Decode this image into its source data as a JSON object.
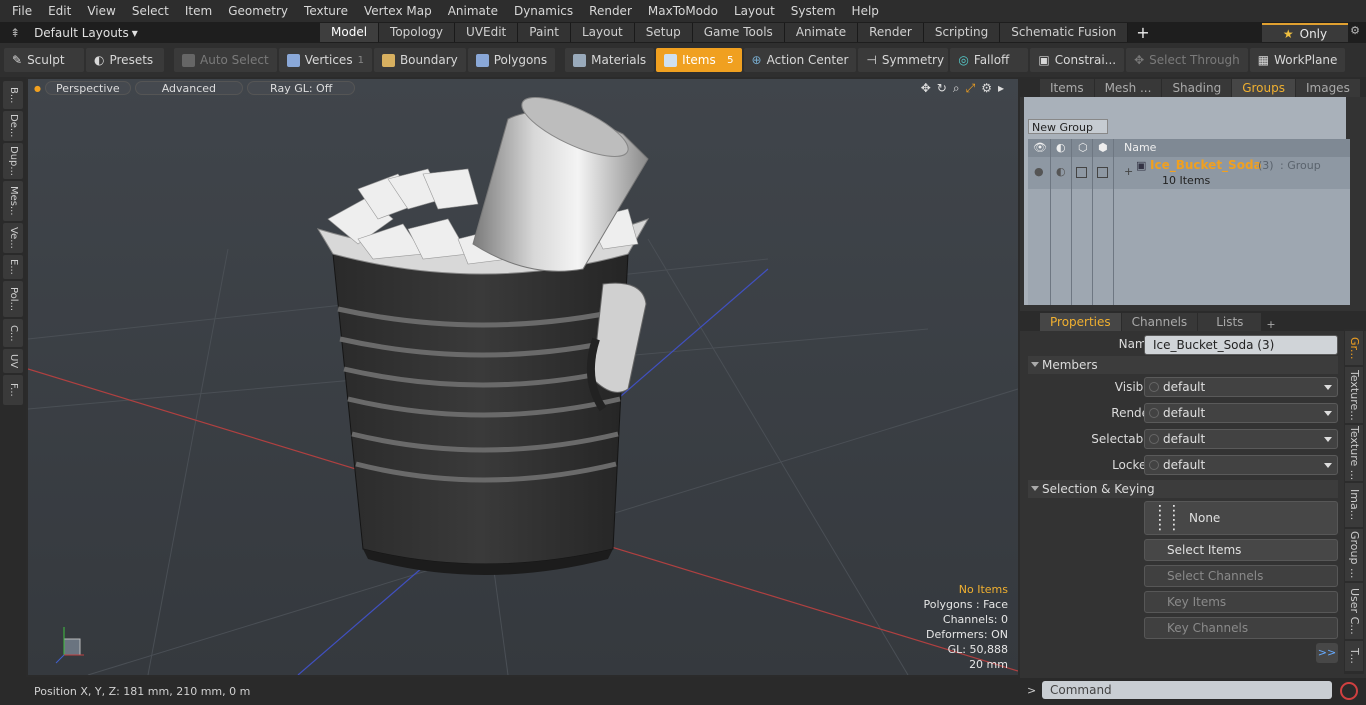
{
  "menu": [
    "File",
    "Edit",
    "View",
    "Select",
    "Item",
    "Geometry",
    "Texture",
    "Vertex Map",
    "Animate",
    "Dynamics",
    "Render",
    "MaxToModo",
    "Layout",
    "System",
    "Help"
  ],
  "layouts_label": "Default Layouts",
  "tabs": [
    "Model",
    "Topology",
    "UVEdit",
    "Paint",
    "Layout",
    "Setup",
    "Game Tools",
    "Animate",
    "Render",
    "Scripting",
    "Schematic Fusion"
  ],
  "only_label": "Only",
  "toolbar": {
    "sculpt": "Sculpt",
    "presets": "Presets",
    "auto_select": "Auto Select",
    "vertices": "Vertices",
    "vertices_count": "1",
    "boundary": "Boundary",
    "polygons": "Polygons",
    "materials": "Materials",
    "items": "Items",
    "items_count": "5",
    "action_center": "Action Center",
    "symmetry": "Symmetry",
    "falloff": "Falloff",
    "constraints": "Constrai...",
    "select_through": "Select Through",
    "workplane": "WorkPlane"
  },
  "left_tabs": [
    "B...",
    "De...",
    "Dup...",
    "Mes...",
    "Ve...",
    "E...",
    "Pol...",
    "C...",
    "UV",
    "F..."
  ],
  "viewport": {
    "view": "Perspective",
    "advanced": "Advanced",
    "raygl": "Ray GL: Off"
  },
  "info": {
    "items": "No Items",
    "polygons": "Polygons : Face",
    "channels": "Channels: 0",
    "deformers": "Deformers: ON",
    "gl": "GL: 50,888",
    "scale": "20 mm"
  },
  "status": {
    "position": "Position X, Y, Z:   181 mm, 210 mm, 0 m"
  },
  "top_tabs": [
    "Items",
    "Mesh ...",
    "Shading",
    "Groups",
    "Images"
  ],
  "groups": {
    "new_group": "New Group",
    "col_name": "Name",
    "group_name": "Ice_Bucket_Soda",
    "group_count": "(3)",
    "group_type": ": Group",
    "group_items": "10 Items"
  },
  "prop_tabs": [
    "Properties",
    "Channels",
    "Lists"
  ],
  "props": {
    "name_label": "Name",
    "name_value": "Ice_Bucket_Soda (3)",
    "members": "Members",
    "visible": "Visible",
    "render": "Render",
    "selectable": "Selectable",
    "locked": "Locked",
    "default": "default",
    "sel_keying": "Selection & Keying",
    "none": "None",
    "select_items": "Select Items",
    "select_channels": "Select Channels",
    "key_items": "Key Items",
    "key_channels": "Key Channels",
    "more": ">>"
  },
  "side_tabs": [
    "Gr...",
    "Texture...",
    "Texture ...",
    "Ima...",
    "Group ...",
    "User C...",
    "T..."
  ],
  "command_placeholder": "Command"
}
